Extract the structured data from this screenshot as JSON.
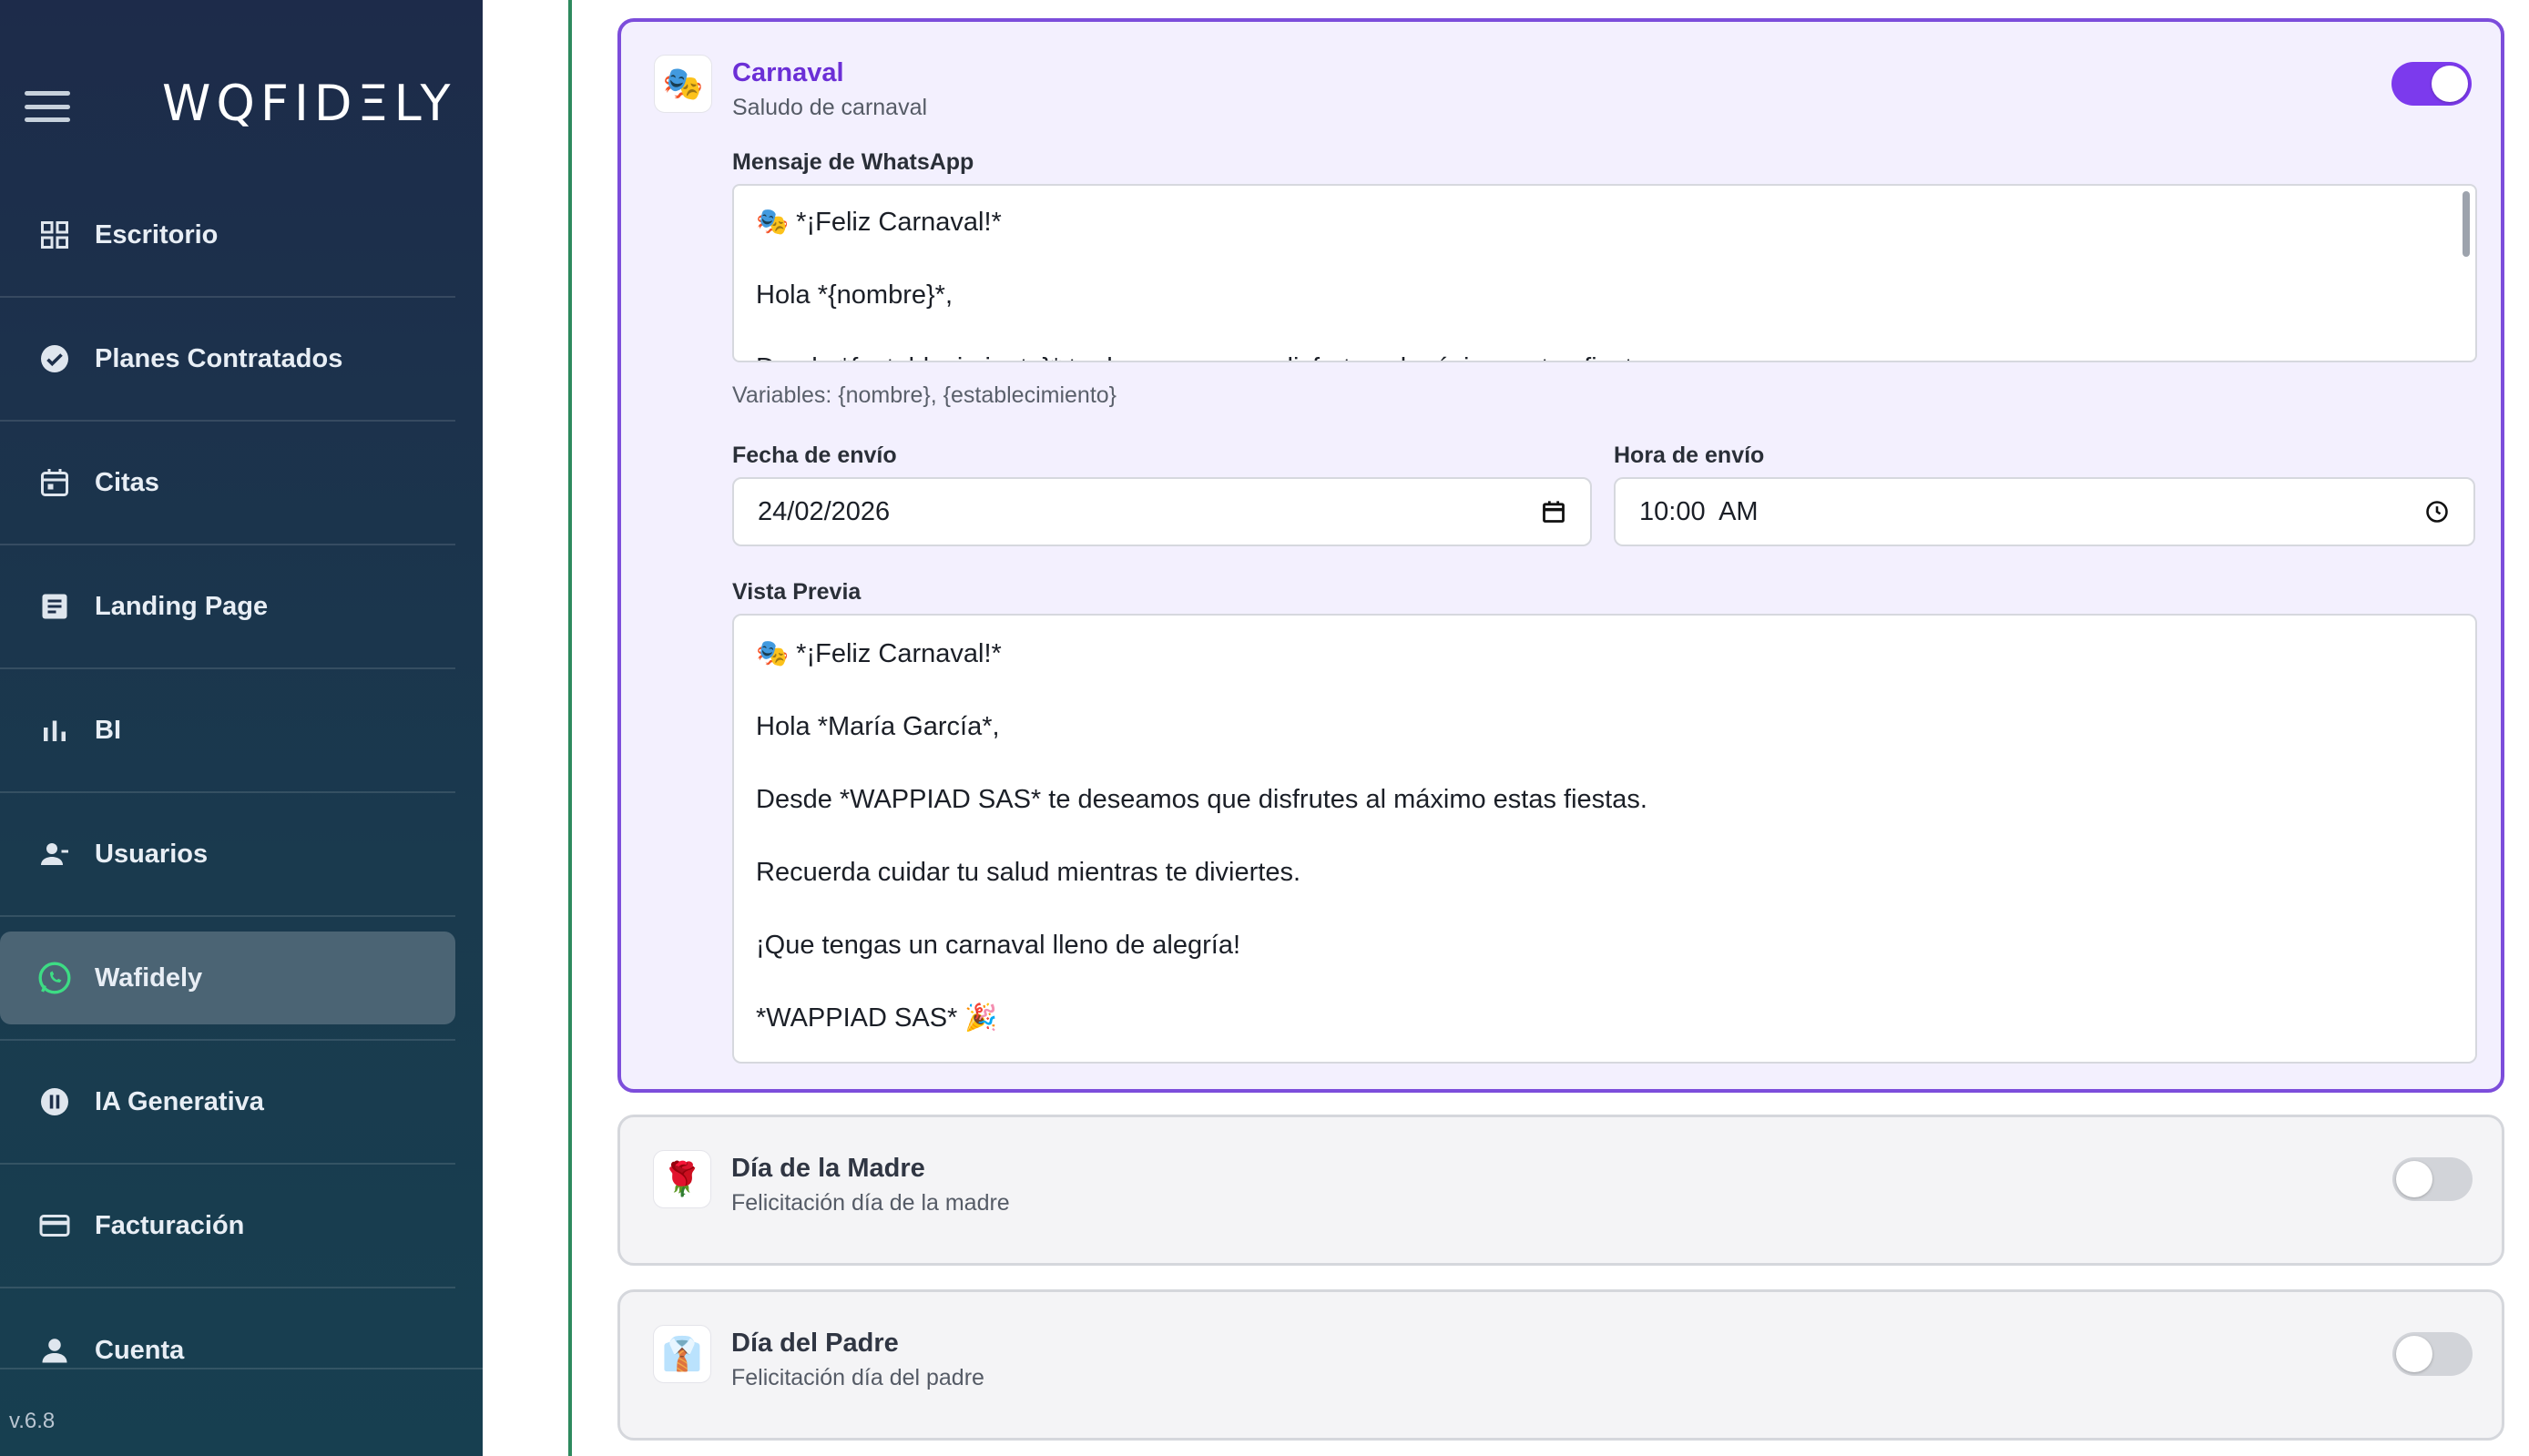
{
  "sidebar": {
    "logo": "WQFIDΞLY",
    "version": "v.6.8",
    "items": [
      {
        "label": "Escritorio",
        "icon": "dashboard-icon"
      },
      {
        "label": "Planes Contratados",
        "icon": "check-circle-icon"
      },
      {
        "label": "Citas",
        "icon": "calendar-icon"
      },
      {
        "label": "Landing Page",
        "icon": "document-icon"
      },
      {
        "label": "BI",
        "icon": "bar-chart-icon"
      },
      {
        "label": "Usuarios",
        "icon": "users-icon"
      },
      {
        "label": "Wafidely",
        "icon": "whatsapp-icon"
      },
      {
        "label": "IA Generativa",
        "icon": "ai-icon"
      },
      {
        "label": "Facturación",
        "icon": "credit-card-icon"
      },
      {
        "label": "Cuenta",
        "icon": "account-icon"
      }
    ]
  },
  "cards": {
    "carnaval": {
      "title": "Carnaval",
      "subtitle": "Saludo de carnaval",
      "icon_glyph": "🎭",
      "enabled": true,
      "message_label": "Mensaje de WhatsApp",
      "message_lines": [
        "🎭 *¡Feliz Carnaval!*",
        "Hola *{nombre}*,",
        "Desde *{establecimiento}* te deseamos que disfrutes al máximo estas fiestas."
      ],
      "variables_hint": "Variables: {nombre}, {establecimiento}",
      "date_label": "Fecha de envío",
      "date_value": "24/02/2026",
      "time_label": "Hora de envío",
      "time_value": "10:00  AM",
      "preview_label": "Vista Previa",
      "preview_lines": [
        "🎭 *¡Feliz Carnaval!*",
        "Hola *María García*,",
        "Desde *WAPPIAD SAS* te deseamos que disfrutes al máximo estas fiestas.",
        "Recuerda cuidar tu salud mientras te diviertes.",
        "¡Que tengas un carnaval lleno de alegría!",
        "*WAPPIAD SAS* 🎉"
      ]
    },
    "madre": {
      "title": "Día de la Madre",
      "subtitle": "Felicitación día de la madre",
      "icon_glyph": "🌹",
      "enabled": false
    },
    "padre": {
      "title": "Día del Padre",
      "subtitle": "Felicitación día del padre",
      "icon_glyph": "👔",
      "enabled": false
    }
  },
  "colors": {
    "accent": "#7c3aed",
    "sidebar_bg": "#1d2b4a",
    "active_nav": "#4b6474",
    "divider": "#2e8a5e"
  }
}
